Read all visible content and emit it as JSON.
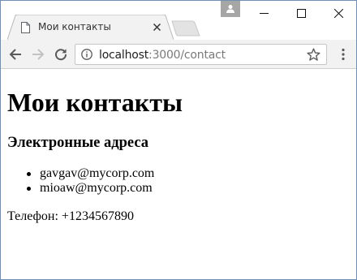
{
  "browser": {
    "tab": {
      "title": "Мои контакты"
    },
    "address_bar": {
      "host": "localhost",
      "path": ":3000/contact"
    }
  },
  "page": {
    "title": "Мои контакты",
    "emails_heading": "Электронные адреса",
    "emails": [
      "gavgav@mycorp.com",
      "mioaw@mycorp.com"
    ],
    "phone": "Телефон: +1234567890"
  },
  "colors": {
    "window_border": "#6f8fb5",
    "toolbar_bg": "#f2f2f2",
    "tab_border": "#b8b8b8",
    "profile_button": "#a6a6a6",
    "url_path": "#7a7a7a"
  },
  "icons": {
    "tab": "page-icon",
    "tab_close": "close-icon",
    "profile": "person-icon",
    "back": "arrow-left-icon",
    "forward": "arrow-right-icon",
    "reload": "reload-icon",
    "site_info": "info-icon",
    "bookmark": "star-icon",
    "menu": "kebab-menu-icon"
  }
}
